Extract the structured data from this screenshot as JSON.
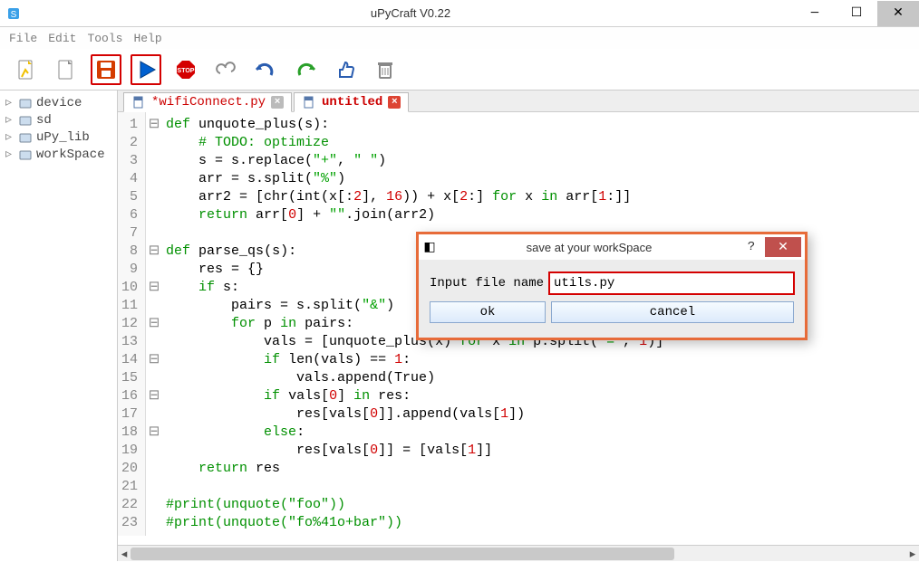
{
  "window": {
    "title": "uPyCraft V0.22",
    "menu": [
      "File",
      "Edit",
      "Tools",
      "Help"
    ]
  },
  "toolbar": {
    "items": [
      {
        "name": "new-file-icon",
        "color": "#f0c000"
      },
      {
        "name": "open-file-icon",
        "color": "#555"
      },
      {
        "name": "save-icon",
        "color": "#d43c00",
        "hl": true
      },
      {
        "name": "run-icon",
        "color": "#0060d0",
        "hl": true
      },
      {
        "name": "stop-icon",
        "color": "#d40000"
      },
      {
        "name": "connect-icon",
        "color": "#888"
      },
      {
        "name": "undo-icon",
        "color": "#2a5db0"
      },
      {
        "name": "redo-icon",
        "color": "#2aa02a"
      },
      {
        "name": "thumbs-up-icon",
        "color": "#2a5db0"
      },
      {
        "name": "trash-icon",
        "color": "#888"
      }
    ]
  },
  "tree": {
    "items": [
      {
        "label": "device",
        "name": "tree-item-device"
      },
      {
        "label": "sd",
        "name": "tree-item-sd"
      },
      {
        "label": "uPy_lib",
        "name": "tree-item-upylib"
      },
      {
        "label": "workSpace",
        "name": "tree-item-workspace"
      }
    ]
  },
  "tabs": [
    {
      "label": "*wifiConnect.py",
      "dirty": true,
      "active": false,
      "closeStyle": "gray"
    },
    {
      "label": "untitled",
      "dirty": false,
      "active": true,
      "closeStyle": "red"
    }
  ],
  "code": {
    "lines": [
      {
        "n": 1,
        "fold": "⊟",
        "html": "<span class='kw'>def</span> <span class='fn'>unquote_plus</span>(s):"
      },
      {
        "n": 2,
        "fold": " ",
        "html": "    <span class='cm'># TODO: optimize</span>"
      },
      {
        "n": 3,
        "fold": " ",
        "html": "    s = s.replace(<span class='st'>\"+\"</span>, <span class='st'>\" \"</span>)"
      },
      {
        "n": 4,
        "fold": " ",
        "html": "    arr = s.split(<span class='st'>\"%\"</span>)"
      },
      {
        "n": 5,
        "fold": " ",
        "html": "    arr2 = [chr(int(x[:<span class='nm'>2</span>], <span class='nm'>16</span>)) + x[<span class='nm'>2</span>:] <span class='kw'>for</span> x <span class='kw'>in</span> arr[<span class='nm'>1</span>:]]"
      },
      {
        "n": 6,
        "fold": " ",
        "html": "    <span class='kw'>return</span> arr[<span class='nm'>0</span>] + <span class='st'>\"\"</span>.join(arr2)"
      },
      {
        "n": 7,
        "fold": " ",
        "html": ""
      },
      {
        "n": 8,
        "fold": "⊟",
        "html": "<span class='kw'>def</span> <span class='fn'>parse_qs</span>(s):"
      },
      {
        "n": 9,
        "fold": " ",
        "html": "    res = {}"
      },
      {
        "n": 10,
        "fold": "⊟",
        "html": "    <span class='kw'>if</span> s:"
      },
      {
        "n": 11,
        "fold": " ",
        "html": "        pairs = s.split(<span class='st'>\"&\"</span>)"
      },
      {
        "n": 12,
        "fold": "⊟",
        "html": "        <span class='kw'>for</span> p <span class='kw'>in</span> pairs:"
      },
      {
        "n": 13,
        "fold": " ",
        "html": "            vals = [unquote_plus(x) <span class='kw'>for</span> x <span class='kw'>in</span> p.split(<span class='st'>\"=\"</span>, <span class='nm'>1</span>)]"
      },
      {
        "n": 14,
        "fold": "⊟",
        "html": "            <span class='kw'>if</span> len(vals) == <span class='nm'>1</span>:"
      },
      {
        "n": 15,
        "fold": " ",
        "html": "                vals.append(True)"
      },
      {
        "n": 16,
        "fold": "⊟",
        "html": "            <span class='kw'>if</span> vals[<span class='nm'>0</span>] <span class='kw'>in</span> res:"
      },
      {
        "n": 17,
        "fold": " ",
        "html": "                res[vals[<span class='nm'>0</span>]].append(vals[<span class='nm'>1</span>])"
      },
      {
        "n": 18,
        "fold": "⊟",
        "html": "            <span class='kw'>else</span>:"
      },
      {
        "n": 19,
        "fold": " ",
        "html": "                res[vals[<span class='nm'>0</span>]] = [vals[<span class='nm'>1</span>]]"
      },
      {
        "n": 20,
        "fold": " ",
        "html": "    <span class='kw'>return</span> res"
      },
      {
        "n": 21,
        "fold": " ",
        "html": ""
      },
      {
        "n": 22,
        "fold": " ",
        "html": "<span class='cm'>#print(unquote(\"foo\"))</span>"
      },
      {
        "n": 23,
        "fold": " ",
        "html": "<span class='cm'>#print(unquote(\"fo%41o+bar\"))</span>"
      }
    ]
  },
  "dialog": {
    "title": "save at your workSpace",
    "label": "Input file name",
    "value": "utils.py",
    "ok": "ok",
    "cancel": "cancel"
  }
}
